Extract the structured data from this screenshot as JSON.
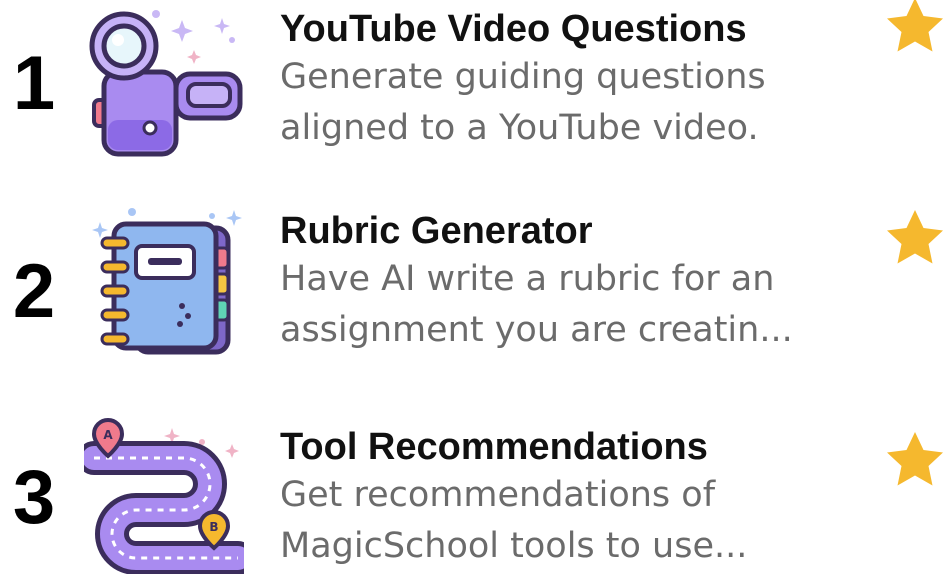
{
  "colors": {
    "star": "#f5b82e",
    "title": "#111111",
    "description": "#6b6b6b",
    "rank": "#000000"
  },
  "items": [
    {
      "rank": "1",
      "icon": "video-camera-icon",
      "title": "YouTube Video Questions",
      "description_lines": [
        "Generate guiding questions",
        "aligned to a YouTube video."
      ],
      "favorite": "star-icon"
    },
    {
      "rank": "2",
      "icon": "notebook-icon",
      "title": "Rubric Generator",
      "description_lines": [
        "Have AI write a rubric for an",
        "assignment you are creatin..."
      ],
      "favorite": "star-icon"
    },
    {
      "rank": "3",
      "icon": "road-map-icon",
      "title": "Tool Recommendations",
      "description_lines": [
        "Get recommendations of",
        "MagicSchool tools to use..."
      ],
      "favorite": "star-icon"
    }
  ]
}
